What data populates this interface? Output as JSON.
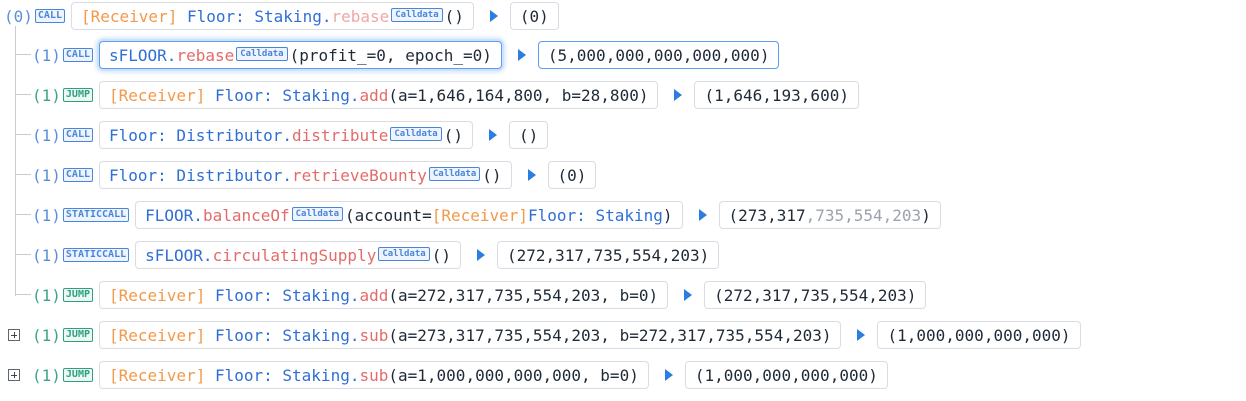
{
  "colors": {
    "receiver": "#f19a4a",
    "contract": "#2f6fd6",
    "method": "#e36b6b",
    "call_badge": "#4a86d8",
    "jump_badge": "#2f9f80",
    "arrow": "#2b7de0"
  },
  "rows": [
    {
      "depth": "(0)",
      "type": "CALL",
      "receiver": "[Receiver]",
      "contract": "Floor: Staking",
      "sep": ".",
      "method": "rebase",
      "calldata": "Calldata",
      "args": "()",
      "ret": "(0)"
    },
    {
      "depth": "(1)",
      "type": "CALL",
      "contract": "sFLOOR",
      "sep": ".",
      "method": "rebase",
      "calldata": "Calldata",
      "args": "(profit_=0, epoch_=0)",
      "ret": "(5,000,000,000,000,000)",
      "selected": true
    },
    {
      "depth": "(1)",
      "type": "JUMP",
      "receiver": "[Receiver]",
      "contract": "Floor: Staking",
      "sep": ".",
      "method": "add",
      "args": "(a=1,646,164,800, b=28,800)",
      "ret": "(1,646,193,600)"
    },
    {
      "depth": "(1)",
      "type": "CALL",
      "contract": "Floor: Distributor",
      "sep": ".",
      "method": "distribute",
      "calldata": "Calldata",
      "args": "()",
      "ret": "()"
    },
    {
      "depth": "(1)",
      "type": "CALL",
      "contract": "Floor: Distributor",
      "sep": ".",
      "method": "retrieveBounty",
      "calldata": "Calldata",
      "args": "()",
      "ret": "(0)"
    },
    {
      "depth": "(1)",
      "type": "STATICCALL",
      "contract": "FLOOR",
      "sep": ".",
      "method": "balanceOf",
      "calldata": "Calldata",
      "args_pre": "(account=",
      "args_recv": "[Receiver]",
      "args_contract": "Floor: Staking",
      "args_post": ")",
      "ret_main": "(273,317",
      "ret_fade": ",735,554,203",
      "ret_end": ")"
    },
    {
      "depth": "(1)",
      "type": "STATICCALL",
      "contract": "sFLOOR",
      "sep": ".",
      "method": "circulatingSupply",
      "calldata": "Calldata",
      "args": "()",
      "ret": "(272,317,735,554,203)"
    },
    {
      "depth": "(1)",
      "type": "JUMP",
      "receiver": "[Receiver]",
      "contract": "Floor: Staking",
      "sep": ".",
      "method": "add",
      "args": "(a=272,317,735,554,203, b=0)",
      "ret": "(272,317,735,554,203)"
    },
    {
      "depth": "(1)",
      "type": "JUMP",
      "receiver": "[Receiver]",
      "contract": "Floor: Staking",
      "sep": ".",
      "method": "sub",
      "args": "(a=273,317,735,554,203, b=272,317,735,554,203)",
      "ret": "(1,000,000,000,000)"
    },
    {
      "depth": "(1)",
      "type": "JUMP",
      "receiver": "[Receiver]",
      "contract": "Floor: Staking",
      "sep": ".",
      "method": "sub",
      "args": "(a=1,000,000,000,000, b=0)",
      "ret": "(1,000,000,000,000)"
    }
  ]
}
